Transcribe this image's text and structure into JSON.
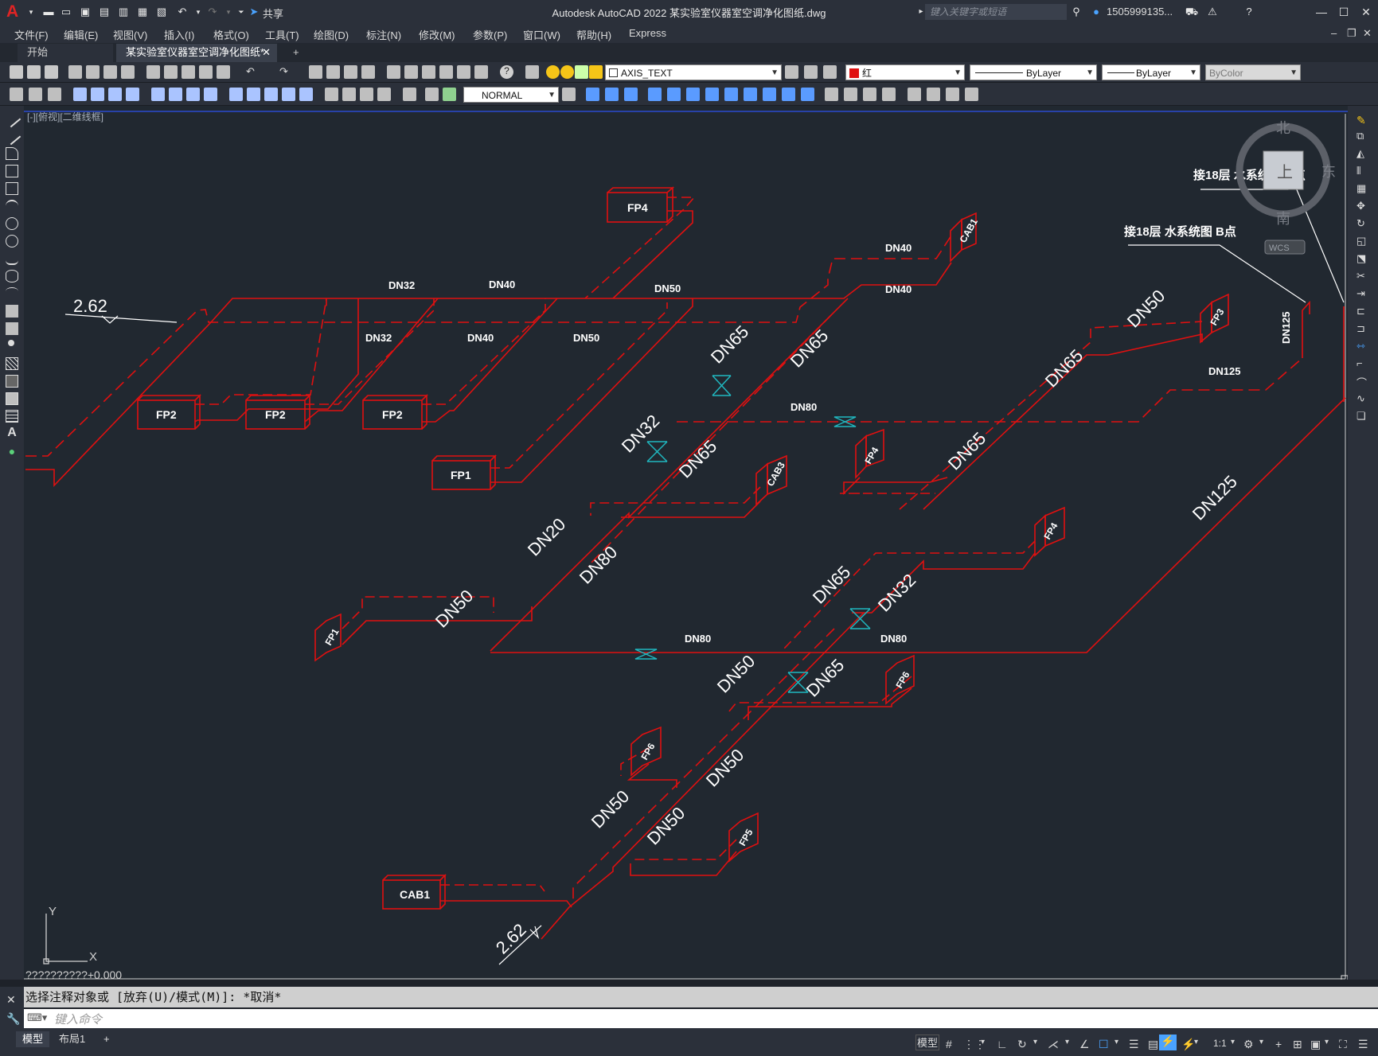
{
  "app": {
    "title": "Autodesk AutoCAD 2022    某实验室仪器室空调净化图纸.dwg",
    "search_placeholder": "键入关键字或短语",
    "user": "1505999135...",
    "share_label": "共享"
  },
  "menu": [
    "文件(F)",
    "编辑(E)",
    "视图(V)",
    "插入(I)",
    "格式(O)",
    "工具(T)",
    "绘图(D)",
    "标注(N)",
    "修改(M)",
    "参数(P)",
    "窗口(W)",
    "帮助(H)",
    "Express"
  ],
  "tabs": [
    {
      "label": "开始"
    },
    {
      "label": "某实验室仪器室空调净化图纸*"
    }
  ],
  "toolbar": {
    "layer_value": "AXIS_TEXT",
    "color_value": "红",
    "linetype_value": "ByLayer",
    "lineweight_value": "ByLayer",
    "plotstyle_value": "ByColor",
    "dimstyle_value": "NORMAL"
  },
  "viewport": {
    "label": "[-][俯视][二维线框]",
    "compass_n": "北",
    "compass_e": "东",
    "compass_s": "南",
    "compass_center": "上",
    "wcs": "WCS",
    "coord_readout": "??????????+0.000"
  },
  "drawing": {
    "color_pipe": "#e01010",
    "color_valve": "#20b8c0",
    "level_top": "2.62",
    "level_bottom": "2.62",
    "note_c": "接18层 水系统图 C点",
    "note_b": "接18层 水系统图 B点",
    "labels_flat": [
      {
        "text": "FP4",
        "box": true
      },
      {
        "text": "FP2",
        "box": true
      },
      {
        "text": "FP2",
        "box": true
      },
      {
        "text": "FP2",
        "box": true
      },
      {
        "text": "FP1",
        "box": true
      },
      {
        "text": "CAB1",
        "box": true
      },
      {
        "text": "DN32"
      },
      {
        "text": "DN40"
      },
      {
        "text": "DN50"
      },
      {
        "text": "DN32"
      },
      {
        "text": "DN40"
      },
      {
        "text": "DN50"
      },
      {
        "text": "DN40"
      },
      {
        "text": "DN40"
      },
      {
        "text": "DN80"
      },
      {
        "text": "DN125"
      },
      {
        "text": "DN80"
      },
      {
        "text": "DN80"
      }
    ],
    "labels_angled": [
      "DN65",
      "DN65",
      "DN32",
      "DN65",
      "DN20",
      "DN80",
      "DN50",
      "DN50",
      "DN65",
      "DN65",
      "DN65",
      "DN32",
      "DN50",
      "DN65",
      "DN50",
      "DN50",
      "DN50",
      "DN125"
    ],
    "iso_equipment": [
      "CAB1",
      "FP3",
      "FP4",
      "CAB3",
      "FP4",
      "FP1",
      "FP6",
      "FP6",
      "FP5"
    ],
    "dn125_vertical": "DN125"
  },
  "command": {
    "history": "选择注释对象或 [放弃(U)/模式(M)]: *取消*",
    "input_placeholder": "键入命令"
  },
  "status": {
    "model_tab": "模型",
    "layout_tab": "布局1",
    "model_label": "模型",
    "scale": "1:1"
  }
}
